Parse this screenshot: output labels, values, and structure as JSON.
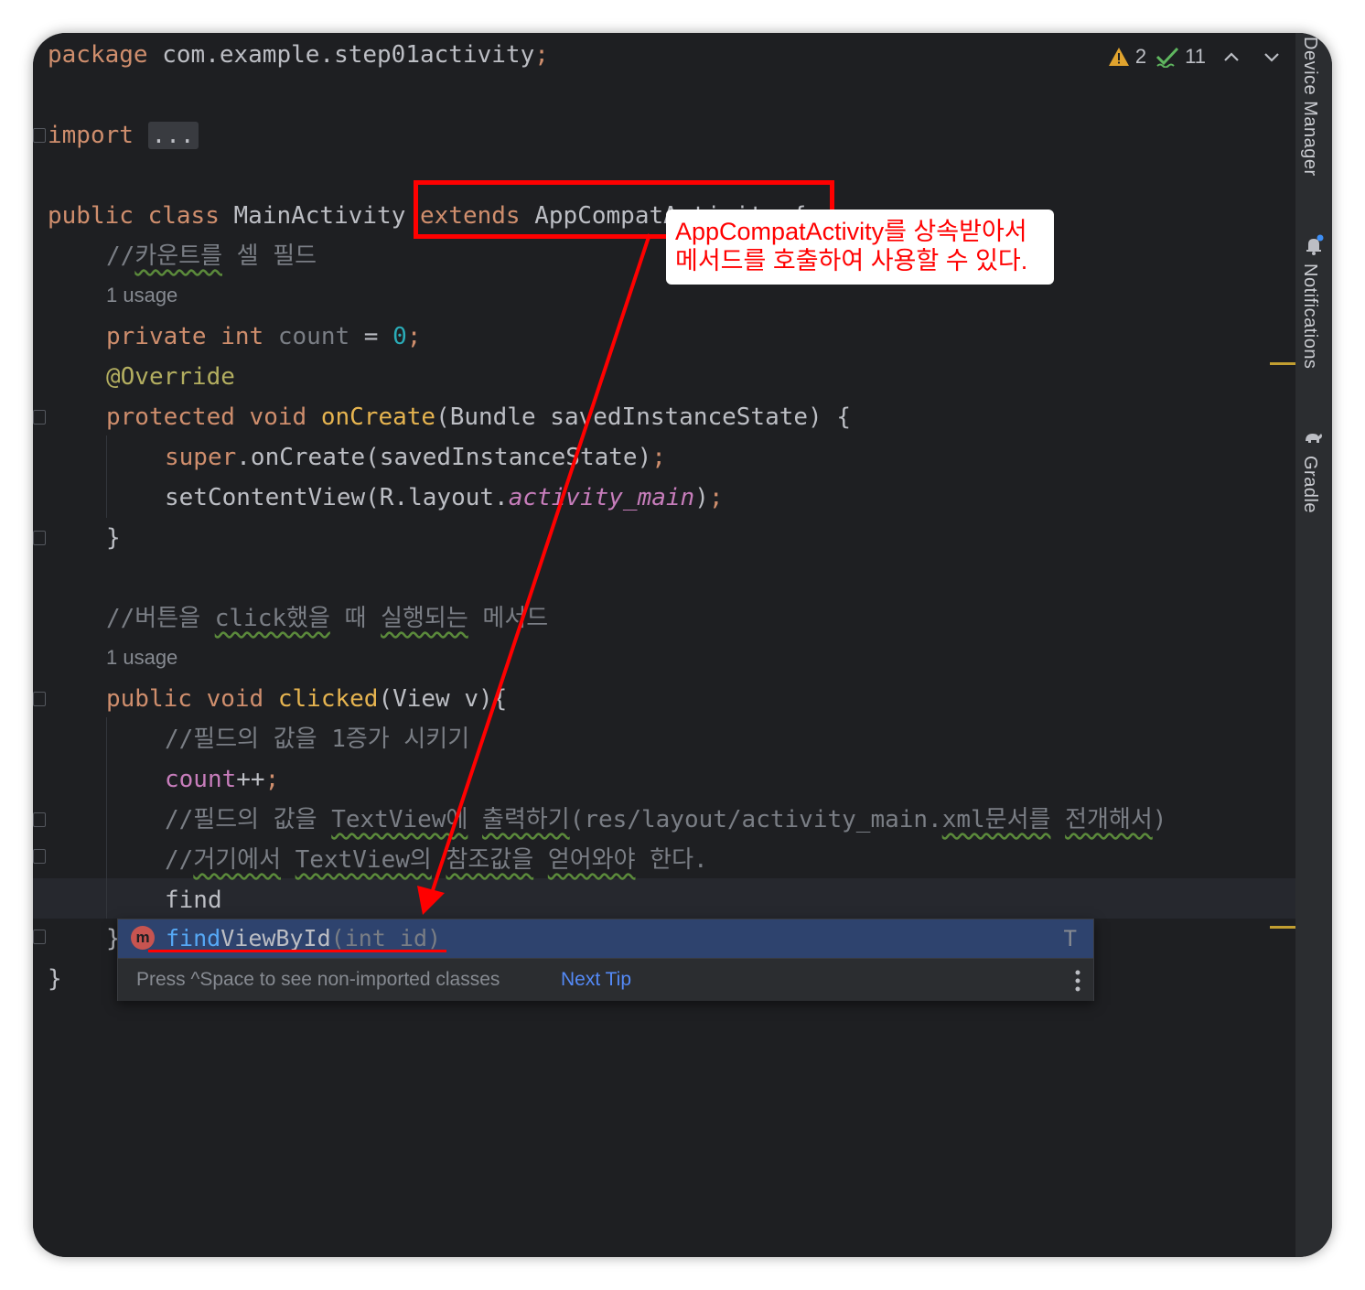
{
  "inspection": {
    "warnings": "2",
    "weak_warnings": "11"
  },
  "code": {
    "l1": {
      "kw": "package",
      "rest": " com.example.step01activity",
      "semi": ";"
    },
    "l2": {
      "kw": "import",
      "fold": "..."
    },
    "l3": {
      "kw1": "public",
      "kw2": "class",
      "name": "MainActivity",
      "kw3": "extends",
      "parent": "AppCompatActivity",
      "brace": " {"
    },
    "l4": {
      "slashes": "//",
      "w1": "카운트를",
      "rest": " 셀 필드"
    },
    "usage1": "1 usage",
    "l5": {
      "kw1": "private",
      "kw2": "int",
      "var": "count",
      "eq": " = ",
      "num": "0",
      "semi": ";"
    },
    "l6": {
      "ann": "@Override"
    },
    "l7": {
      "kw1": "protected",
      "kw2": "void",
      "fn": "onCreate",
      "args": "(Bundle savedInstanceState) {"
    },
    "l8": {
      "kw": "super",
      "rest": ".onCreate(savedInstanceState)",
      "semi": ";"
    },
    "l9": {
      "pre": "setContentView(R.layout.",
      "ita": "activity_main",
      "post": ")",
      "semi": ";"
    },
    "l10": {
      "brace": "}"
    },
    "l11": {
      "slashes": "//버튼을 ",
      "w1": "click했을",
      "mid": " 때 ",
      "w2": "실행되는",
      "rest": " 메서드"
    },
    "usage2": "1 usage",
    "l12": {
      "kw1": "public",
      "kw2": "void",
      "fn": "clicked",
      "args": "(View v){"
    },
    "l13": {
      "text": "//필드의 값을 1증가 시키기"
    },
    "l14": {
      "var": "count",
      "ops": "++",
      "semi": ";"
    },
    "l15": {
      "pre": "//필드의 값을 ",
      "w1": "TextView에",
      "mid": " ",
      "w2": "출력하기",
      "mid2": "(res/layout/activity_main.",
      "w3": "xml문서를",
      "mid3": " ",
      "w4": "전개해서",
      "post": ")"
    },
    "l16": {
      "pre": "//",
      "w1": "거기에서",
      "mid": " ",
      "w2": "TextView의",
      "mid2": " ",
      "w3": "참조값을",
      "mid3": " ",
      "w4": "얻어와야",
      "post": " 한다."
    },
    "l17": {
      "text": "find"
    },
    "l18": {
      "brace": "}"
    },
    "l19": {
      "brace": "}"
    }
  },
  "completion": {
    "icon_letter": "m",
    "match": "find",
    "rest": "ViewById",
    "params": "(int id)",
    "type": "T",
    "hint": "Press ^Space to see non-imported classes",
    "next_tip": "Next Tip"
  },
  "sidebar": {
    "device_manager": "Device Manager",
    "notifications": "Notifications",
    "gradle": "Gradle"
  },
  "annotation": {
    "line1": "AppCompatActivity를 상속받아서",
    "line2": "메서드를 호출하여 사용할 수 있다.",
    "color": "#ff0000"
  }
}
